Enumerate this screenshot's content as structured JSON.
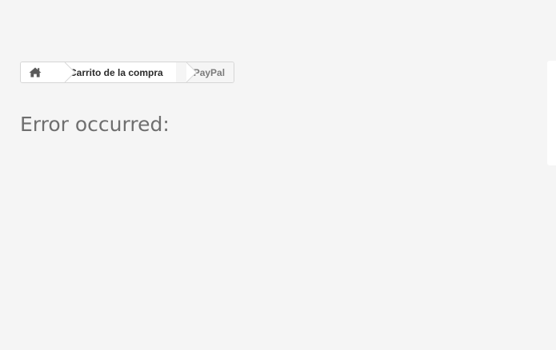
{
  "breadcrumb": {
    "home_icon": "home-icon",
    "items": [
      {
        "label": "Carrito de la compra"
      },
      {
        "label": "PayPal"
      }
    ]
  },
  "main": {
    "title": "Error occurred:"
  },
  "colors": {
    "background": "#f5f5f5",
    "breadcrumb_border": "#d6d6d6",
    "link_text": "#2b2b2b",
    "current_text": "#7b7b7b",
    "title_text": "#6f6f6f"
  }
}
